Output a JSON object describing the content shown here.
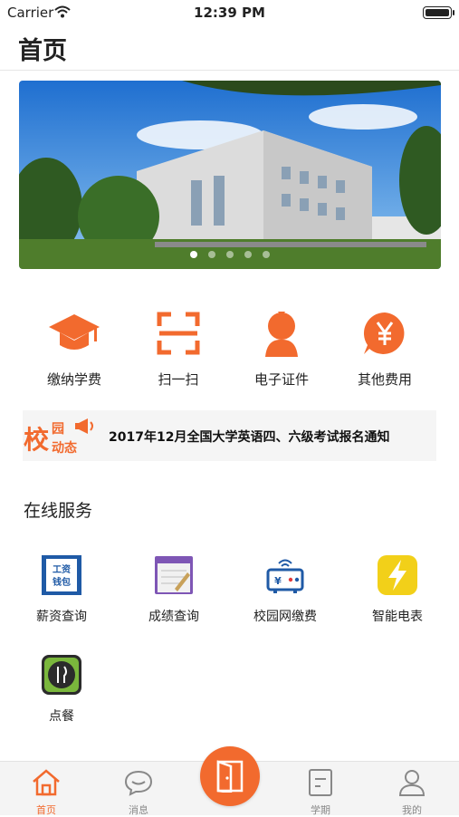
{
  "status_bar": {
    "carrier": "Carrier",
    "time": "12:39 PM"
  },
  "nav": {
    "title": "首页"
  },
  "banner": {
    "slide_count": 5,
    "active_index": 0
  },
  "quick_actions": [
    {
      "label": "缴纳学费",
      "icon": "mortarboard-icon"
    },
    {
      "label": "扫一扫",
      "icon": "scan-icon"
    },
    {
      "label": "电子证件",
      "icon": "person-icon"
    },
    {
      "label": "其他费用",
      "icon": "yen-icon"
    }
  ],
  "news": {
    "logo_text": "校园动态",
    "text": "2017年12月全国大学英语四、六级考试报名通知"
  },
  "online_services": {
    "title": "在线服务",
    "items": [
      {
        "label": "薪资查询",
        "icon": "wage-wallet-icon",
        "icon_text": "工资钱包"
      },
      {
        "label": "成绩查询",
        "icon": "notebook-icon"
      },
      {
        "label": "校园网缴费",
        "icon": "router-icon"
      },
      {
        "label": "智能电表",
        "icon": "lightning-icon"
      },
      {
        "label": "点餐",
        "icon": "cutlery-icon"
      }
    ]
  },
  "tab_bar": {
    "tabs": [
      {
        "label": "首页",
        "icon": "home-icon",
        "active": true
      },
      {
        "label": "消息",
        "icon": "chat-icon",
        "active": false
      },
      {
        "label": "学期",
        "icon": "document-icon",
        "active": false
      },
      {
        "label": "我的",
        "icon": "user-icon",
        "active": false
      }
    ],
    "center_icon": "door-icon"
  },
  "colors": {
    "accent": "#f26a2e",
    "tab_inactive": "#888888",
    "news_bg": "#f5f5f5"
  }
}
